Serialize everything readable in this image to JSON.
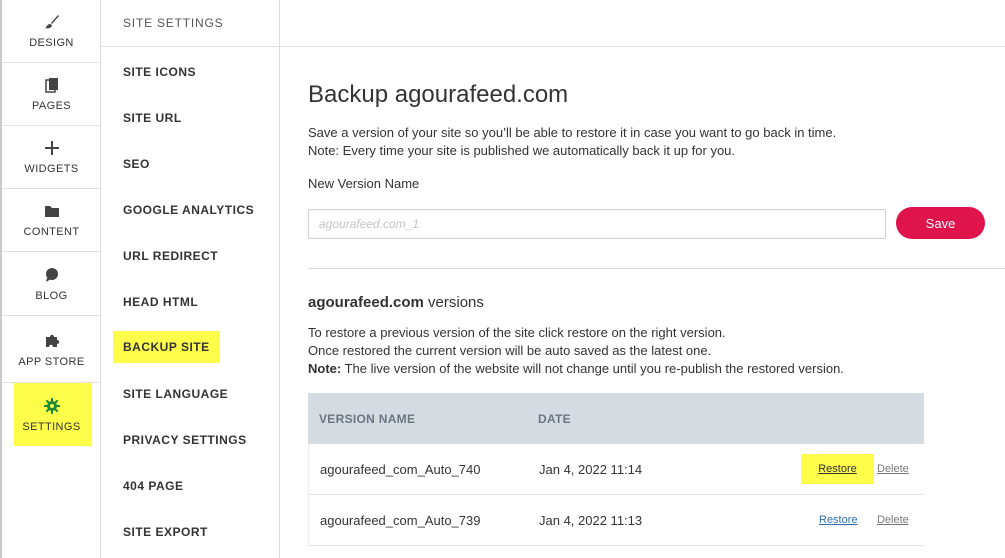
{
  "rail": {
    "items": [
      {
        "label": "DESIGN",
        "icon": "brush-icon"
      },
      {
        "label": "PAGES",
        "icon": "pages-icon"
      },
      {
        "label": "WIDGETS",
        "icon": "plus-icon"
      },
      {
        "label": "CONTENT",
        "icon": "folder-icon"
      },
      {
        "label": "BLOG",
        "icon": "chat-bubble-icon"
      },
      {
        "label": "APP STORE",
        "icon": "puzzle-icon"
      },
      {
        "label": "SETTINGS",
        "icon": "gear-icon"
      }
    ],
    "active": "SETTINGS",
    "highlight_color": "#fdfd4a"
  },
  "settings_menu": {
    "heading": "SITE SETTINGS",
    "items": [
      "SITE ICONS",
      "SITE URL",
      "SEO",
      "GOOGLE ANALYTICS",
      "URL REDIRECT",
      "HEAD HTML",
      "BACKUP SITE",
      "SITE LANGUAGE",
      "PRIVACY SETTINGS",
      "404 PAGE",
      "SITE EXPORT"
    ],
    "active": "BACKUP SITE"
  },
  "main": {
    "title": "Backup agourafeed.com",
    "description_line1": "Save a version of your site so you’ll be able to restore it in case you want to go back in time.",
    "description_line2": "Note: Every time your site is published we automatically back it up for you.",
    "new_version_label": "New Version Name",
    "new_version_placeholder": "agourafeed.com_1",
    "new_version_value": "",
    "save_label": "Save",
    "save_color": "#e0144c",
    "versions_site": "agourafeed.com",
    "versions_suffix": " versions",
    "info_line1": "To restore a previous version of the site click restore on the right version.",
    "info_line2": "Once restored the current version will be auto saved as the latest one.",
    "info_note_label": "Note:",
    "info_note_text": " The live version of the website will not change until you re-publish the restored version."
  },
  "versions_table": {
    "columns": [
      "VERSION NAME",
      "DATE"
    ],
    "rows": [
      {
        "name": "agourafeed_com_Auto_740",
        "date": "Jan 4, 2022 11:14",
        "restore": "Restore",
        "delete": "Delete"
      },
      {
        "name": "agourafeed_com_Auto_739",
        "date": "Jan 4, 2022 11:13",
        "restore": "Restore",
        "delete": "Delete"
      }
    ]
  }
}
